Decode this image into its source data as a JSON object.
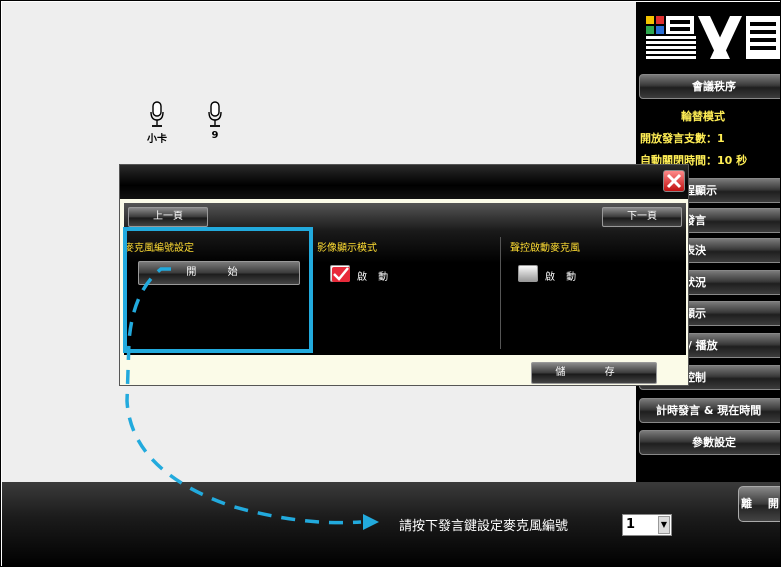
{
  "canvas": {
    "mics": [
      {
        "label": "小卡",
        "icon": "microphone-icon"
      },
      {
        "label": "9",
        "icon": "microphone-icon"
      }
    ]
  },
  "right_panel": {
    "logo": "BXB-logo",
    "meeting_order": "會議秩序",
    "rotation_mode": "輪替模式",
    "open_speech_count": "開放發言支數：1",
    "auto_close_time": "自動關閉時間：10 秒",
    "buttons": [
      "議流程顯示",
      "計時發言",
      "投票表決",
      "出席狀況",
      "即時顯示",
      "錄音 / 播放",
      "視窗控制",
      "計時發言 & 現在時間",
      "參數設定"
    ]
  },
  "dialog": {
    "prev_label": "上一頁",
    "next_label": "下一頁",
    "mic_numbering": {
      "title": "麥克風編號設定",
      "start_label": "開 始"
    },
    "video_mode": {
      "title": "影像顯示模式",
      "checkbox_label": "啟 動",
      "checked": true
    },
    "voice_mode": {
      "title": "聲控啟動麥克風",
      "checkbox_label": "啟 動",
      "checked": false
    },
    "save_label": "儲 存"
  },
  "bottom": {
    "hint": "請按下發言鍵設定麥克風編號",
    "mic_number_value": "1",
    "leave_label": "離 開"
  },
  "colors": {
    "annotation": "#22aadd",
    "section_title": "#ffdd33",
    "info_text": "#ffee55"
  }
}
